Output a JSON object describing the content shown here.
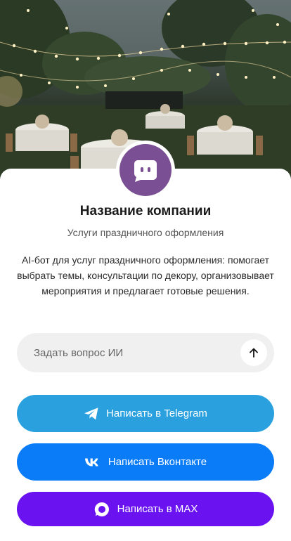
{
  "company": {
    "name": "Название компании",
    "subtitle": "Услуги праздничного оформления",
    "description": "AI-бот для услуг праздничного оформления: помогает выбрать темы, консультации по декору, организовывает мероприятия и предлагает готовые решения."
  },
  "ask": {
    "placeholder": "Задать вопрос ИИ",
    "value": "",
    "send_icon": "arrow-up-icon"
  },
  "buttons": {
    "telegram": {
      "label": "Написать в Telegram",
      "icon": "telegram-icon",
      "color": "#2aa1de"
    },
    "vk": {
      "label": "Написать Вконтакте",
      "icon": "vk-icon",
      "color": "#0a7cf8"
    },
    "max": {
      "label": "Написать в MAX",
      "icon": "max-icon",
      "color": "#6a12f0"
    }
  },
  "avatar": {
    "icon": "chat-bot-icon",
    "color": "#7a4f93"
  }
}
